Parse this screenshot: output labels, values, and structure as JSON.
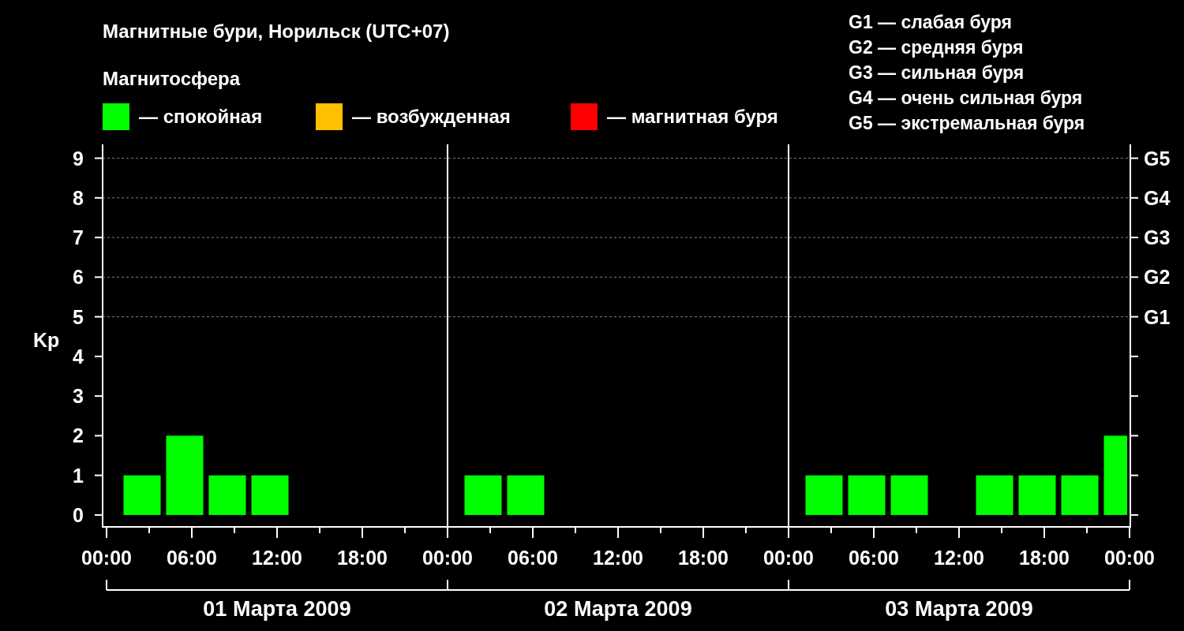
{
  "title": "Магнитные бури, Норильск (UTC+07)",
  "legend_heading": "Магнитосфера",
  "legend": [
    {
      "label": "— спокойная",
      "color": "#00ff00"
    },
    {
      "label": "— возбужденная",
      "color": "#ffc000"
    },
    {
      "label": "— магнитная буря",
      "color": "#ff0000"
    }
  ],
  "scale_notes": [
    "G1 — слабая буря",
    "G2 — средняя буря",
    "G3 — сильная буря",
    "G4 — очень сильная буря",
    "G5 — экстремальная буря"
  ],
  "chart": {
    "chart_data": {
      "type": "bar",
      "ylabel": "Kp",
      "x": [
        "2009-03-01T02:30",
        "2009-03-01T05:30",
        "2009-03-01T08:30",
        "2009-03-01T11:30",
        "2009-03-01T14:30",
        "2009-03-01T17:30",
        "2009-03-01T20:30",
        "2009-03-01T23:30",
        "2009-03-02T02:30",
        "2009-03-02T05:30",
        "2009-03-02T08:30",
        "2009-03-02T11:30",
        "2009-03-02T14:30",
        "2009-03-02T17:30",
        "2009-03-02T20:30",
        "2009-03-02T23:30",
        "2009-03-03T02:30",
        "2009-03-03T05:30",
        "2009-03-03T08:30",
        "2009-03-03T11:30",
        "2009-03-03T14:30",
        "2009-03-03T17:30",
        "2009-03-03T20:30",
        "2009-03-03T23:30"
      ],
      "series": [
        {
          "color": "#00ff00",
          "values": [
            1,
            2,
            1,
            1,
            null,
            null,
            null,
            null,
            1,
            1,
            null,
            null,
            null,
            null,
            null,
            null,
            1,
            1,
            1,
            null,
            1,
            1,
            1,
            2
          ]
        }
      ],
      "xlim": [
        "2009-03-01T00:00",
        "2009-03-04T00:00"
      ],
      "ylim": [
        -0.3,
        9.35
      ],
      "grid": true,
      "yticks": [
        0,
        1,
        2,
        3,
        4,
        5,
        6,
        7,
        8,
        9
      ],
      "xticks": [
        {
          "value": "2009-03-01T00:00",
          "label": "00:00"
        },
        {
          "value": "2009-03-01T06:00",
          "label": "06:00"
        },
        {
          "value": "2009-03-01T12:00",
          "label": "12:00"
        },
        {
          "value": "2009-03-01T18:00",
          "label": "18:00"
        },
        {
          "value": "2009-03-02T00:00",
          "label": "00:00"
        },
        {
          "value": "2009-03-02T06:00",
          "label": "06:00"
        },
        {
          "value": "2009-03-02T12:00",
          "label": "12:00"
        },
        {
          "value": "2009-03-02T18:00",
          "label": "18:00"
        },
        {
          "value": "2009-03-03T00:00",
          "label": "00:00"
        },
        {
          "value": "2009-03-03T06:00",
          "label": "06:00"
        },
        {
          "value": "2009-03-03T12:00",
          "label": "12:00"
        },
        {
          "value": "2009-03-03T18:00",
          "label": "18:00"
        },
        {
          "value": "2009-03-04T00:00",
          "label": "00:00"
        }
      ]
    },
    "right_labels": [
      "G5",
      "G4",
      "G3",
      "G2",
      "G1"
    ],
    "day_labels": [
      "01 Марта 2009",
      "02 Марта 2009",
      "03 Марта 2009"
    ]
  }
}
